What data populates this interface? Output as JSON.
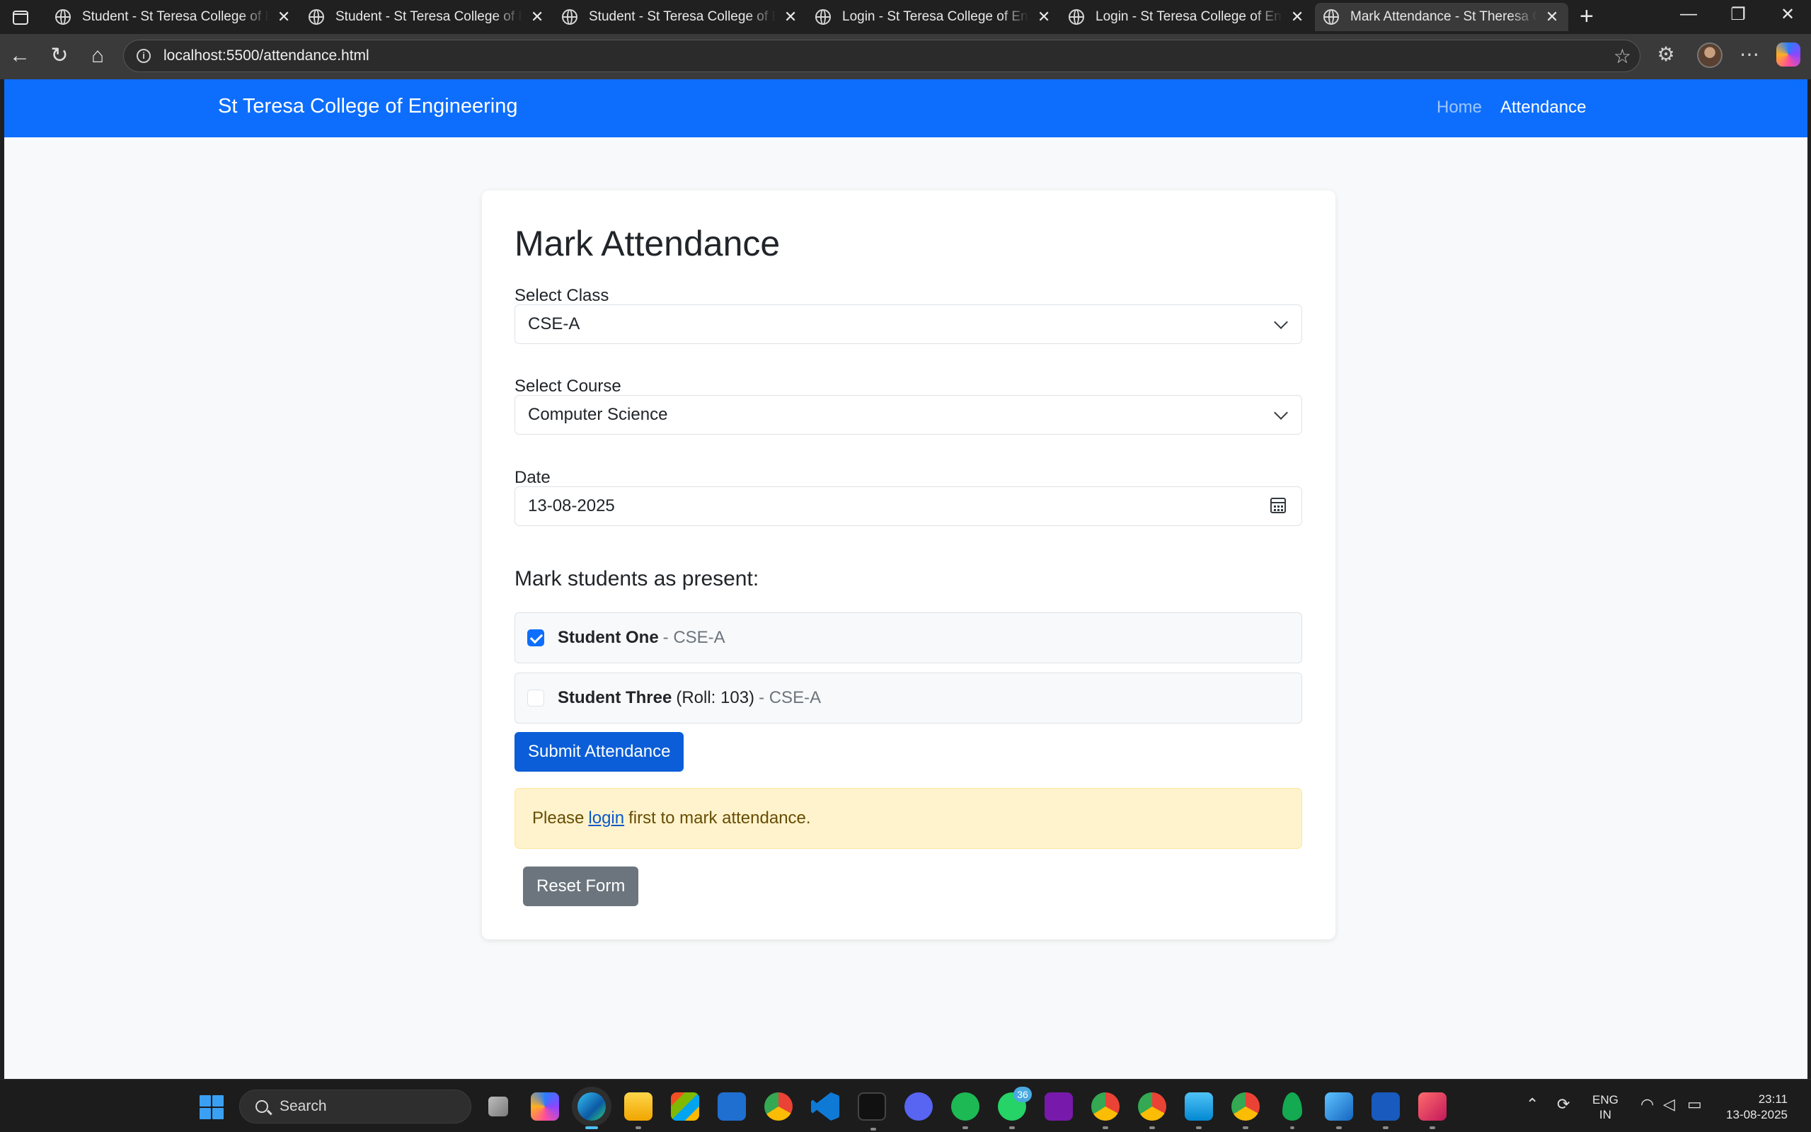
{
  "browser": {
    "tabs": [
      {
        "title": "Student - St Teresa College of Engineering",
        "active": false
      },
      {
        "title": "Student - St Teresa College of Engineering",
        "active": false
      },
      {
        "title": "Student - St Teresa College of Engineering",
        "active": false
      },
      {
        "title": "Login - St Teresa College of Engineering",
        "active": false
      },
      {
        "title": "Login - St Teresa College of Engineering",
        "active": false
      },
      {
        "title": "Mark Attendance - St Theresa College",
        "active": true
      }
    ],
    "close_glyph": "✕",
    "new_tab_glyph": "+",
    "url": "localhost:5500/attendance.html",
    "window_controls": {
      "minimize": "—",
      "restore": "❐",
      "close": "✕"
    }
  },
  "page": {
    "navbar": {
      "brand": "St Teresa College of Engineering",
      "links": [
        "Home",
        "Attendance"
      ],
      "active_link": "Attendance",
      "color": "#0d6efd"
    },
    "form": {
      "title": "Mark Attendance",
      "class_label": "Select Class",
      "class_value": "CSE-A",
      "course_label": "Select Course",
      "course_value": "Computer Science",
      "date_label": "Date",
      "date_value": "13-08-2025",
      "students_heading": "Mark students as present:",
      "students": [
        {
          "name": "Student One",
          "roll": "",
          "class": "- CSE-A",
          "checked": true
        },
        {
          "name": "Student Three",
          "roll": "(Roll: 103)",
          "class": "- CSE-A",
          "checked": false
        }
      ],
      "submit_label": "Submit Attendance",
      "alert": {
        "before": "Please",
        "link": "login",
        "after": "first to mark attendance."
      },
      "reset_label": "Reset Form"
    }
  },
  "taskbar": {
    "search_placeholder": "Search",
    "apps": [
      "task-view",
      "copilot",
      "edge",
      "file-explorer",
      "microsoft-store",
      "sketch-app",
      "chrome",
      "vscode",
      "terminal-app",
      "discord",
      "spotify",
      "whatsapp",
      "onenote",
      "chrome-profile-2",
      "chrome-profile-3",
      "notepad",
      "chrome-profile-4",
      "mongodb-compass",
      "paint",
      "word",
      "snipping-tool"
    ],
    "whatsapp_badge": "36",
    "language": "ENG",
    "region": "IN",
    "time": "23:11",
    "date": "13-08-2025"
  }
}
